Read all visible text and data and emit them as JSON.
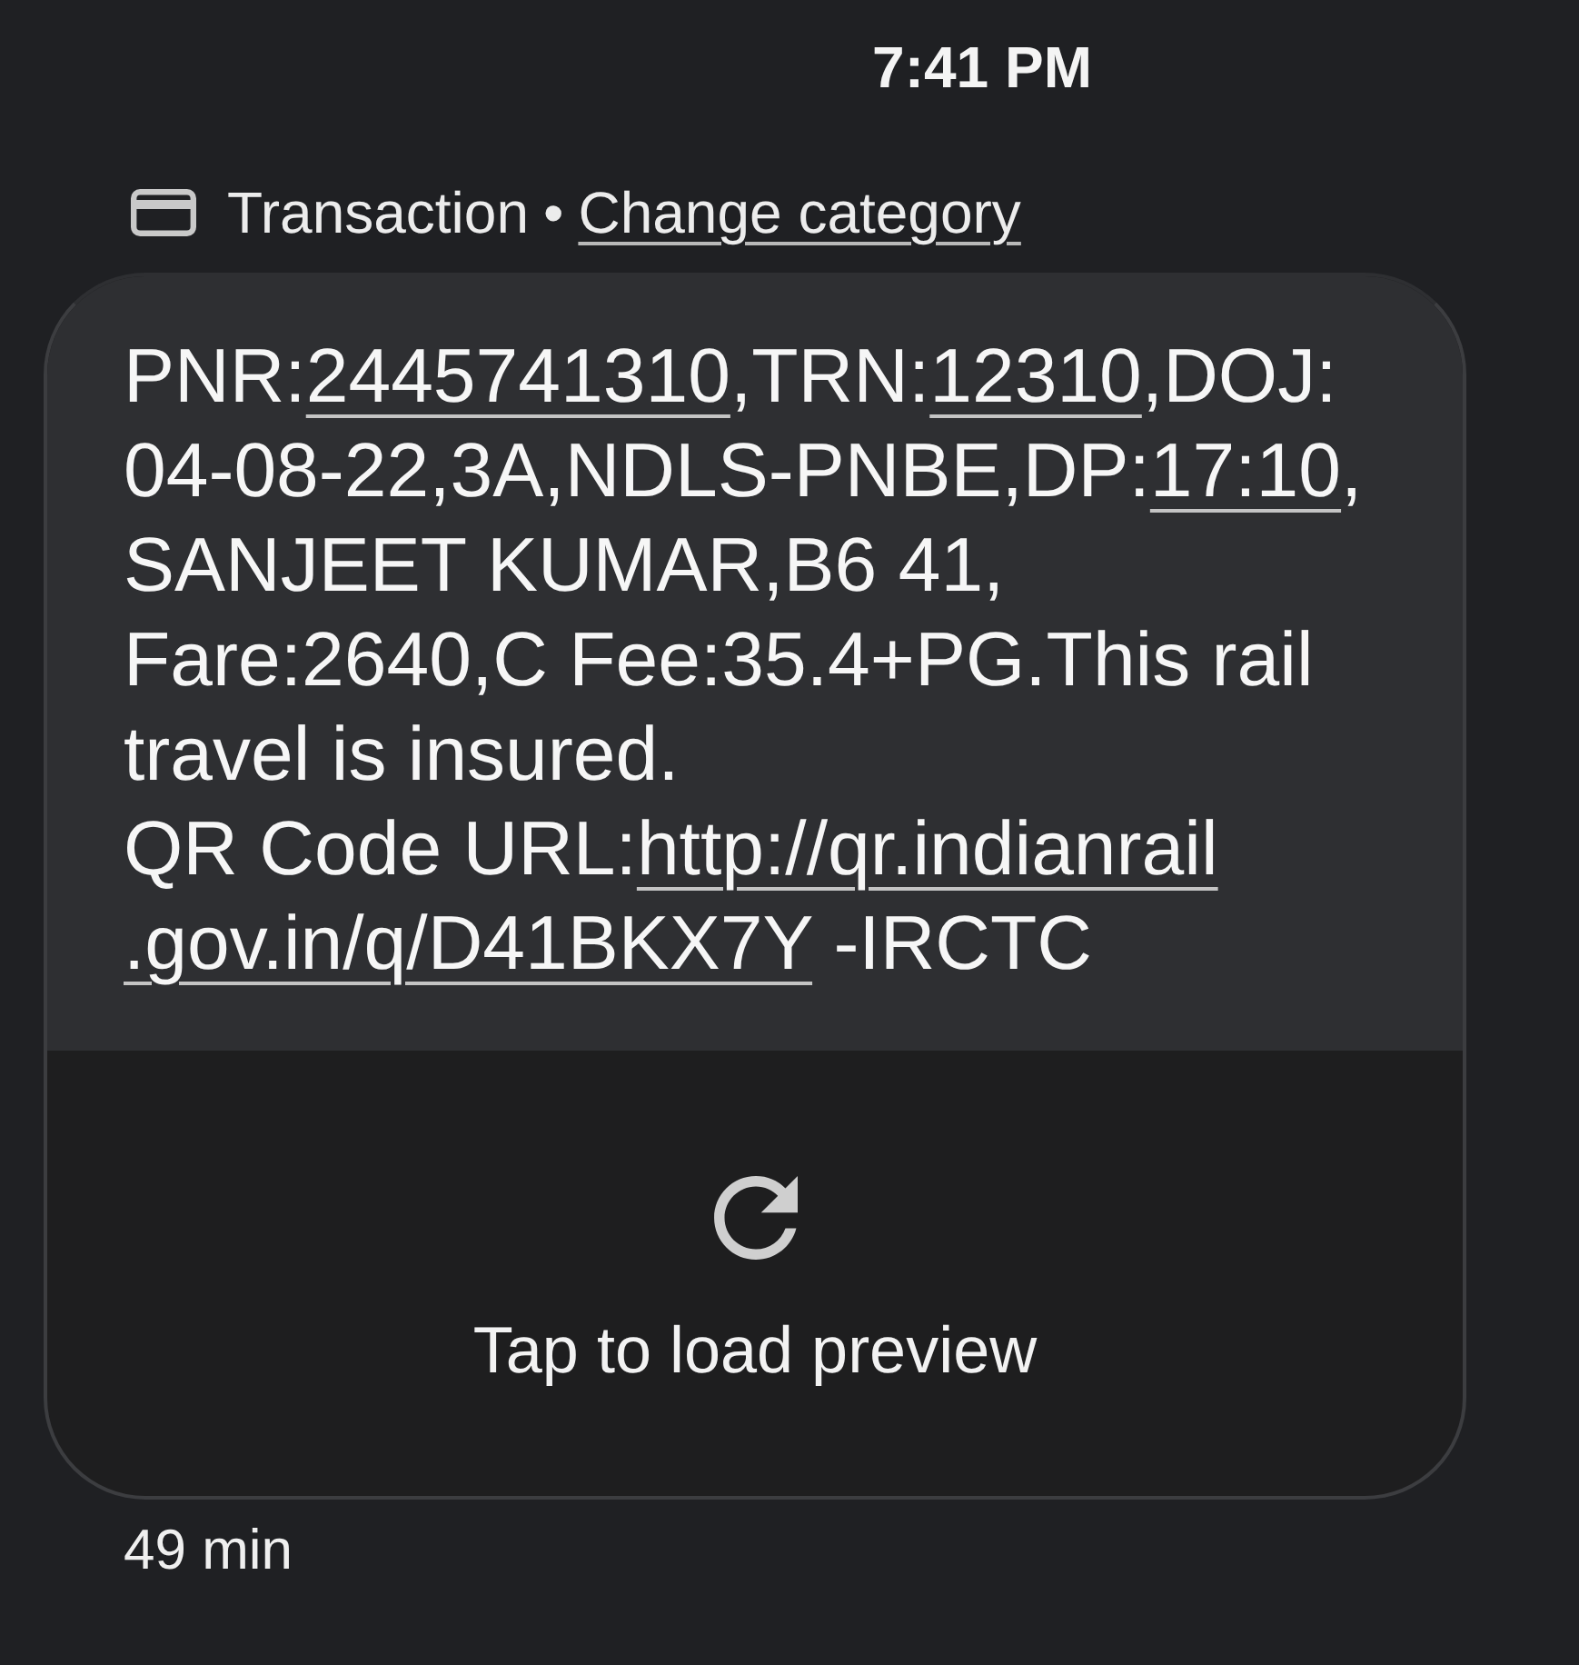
{
  "status": {
    "time": "7:41 PM"
  },
  "category": {
    "label": "Transaction",
    "separator": "•",
    "action": "Change category"
  },
  "message": {
    "lines": [
      [
        {
          "kind": "text",
          "text": "PNR:"
        },
        {
          "kind": "link",
          "text": "2445741310"
        },
        {
          "kind": "text",
          "text": ",TRN:"
        },
        {
          "kind": "link",
          "text": "12310"
        },
        {
          "kind": "text",
          "text": ",DOJ:"
        }
      ],
      [
        {
          "kind": "text",
          "text": "04-08-22,3A,NDLS-PNBE,DP:"
        },
        {
          "kind": "link",
          "text": "17:10"
        },
        {
          "kind": "text",
          "text": ","
        }
      ],
      [
        {
          "kind": "text",
          "text": "SANJEET KUMAR,B6 41,"
        }
      ],
      [
        {
          "kind": "text",
          "text": "Fare:2640,C Fee:35.4+PG.This rail"
        }
      ],
      [
        {
          "kind": "text",
          "text": "travel is insured."
        }
      ],
      [
        {
          "kind": "text",
          "text": "QR Code URL:"
        },
        {
          "kind": "link",
          "text": "http://qr.indianrail"
        }
      ],
      [
        {
          "kind": "link",
          "text": ".gov.in/q/D41BKX7Y"
        },
        {
          "kind": "text",
          "text": " -IRCTC"
        }
      ]
    ]
  },
  "preview": {
    "action": "Tap to load preview"
  },
  "footer": {
    "age": "49 min"
  }
}
